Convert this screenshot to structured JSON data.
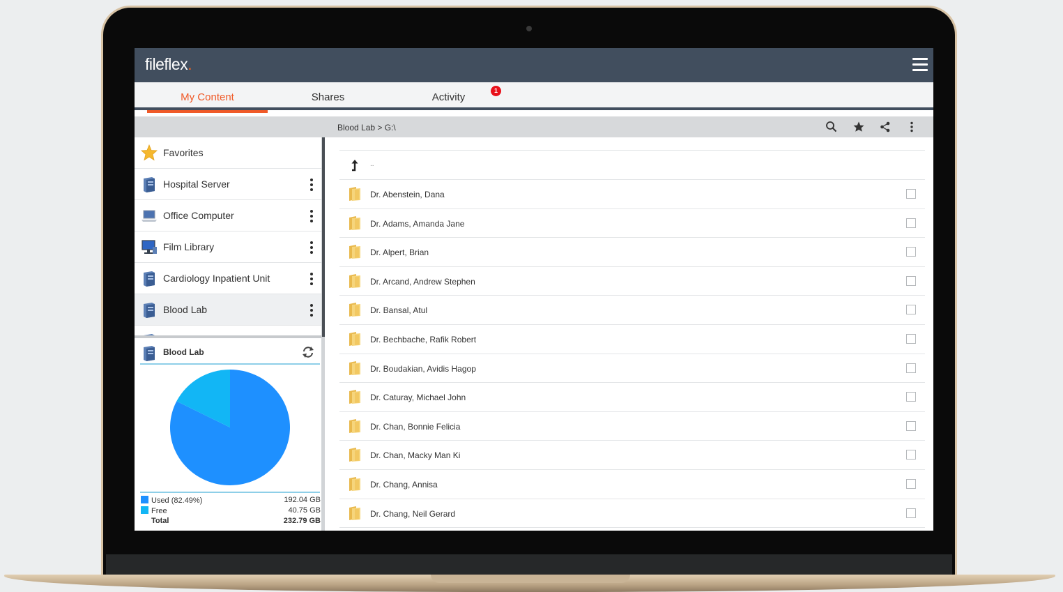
{
  "app": {
    "logo_text": "fileflex",
    "logo_dot": "."
  },
  "tabs": [
    {
      "label": "My Content",
      "active": true
    },
    {
      "label": "Shares",
      "active": false
    },
    {
      "label": "Activity",
      "active": false,
      "badge": "1"
    }
  ],
  "pathbar": {
    "breadcrumb": "Blood Lab > G:\\"
  },
  "sidebar": {
    "items": [
      {
        "label": "Favorites",
        "icon": "star-icon"
      },
      {
        "label": "Hospital Server",
        "icon": "server-icon"
      },
      {
        "label": "Office Computer",
        "icon": "laptop-icon"
      },
      {
        "label": "Film Library",
        "icon": "monitor-icon"
      },
      {
        "label": "Cardiology Inpatient Unit",
        "icon": "server-icon"
      },
      {
        "label": "Blood Lab",
        "icon": "server-icon",
        "selected": true
      }
    ]
  },
  "storage": {
    "title": "Blood Lab",
    "used_label": "Used (82.49%)",
    "used_value": "192.04 GB",
    "free_label": "Free",
    "free_value": "40.75 GB",
    "total_label": "Total",
    "total_value": "232.79 GB",
    "used_fraction": 0.8249,
    "colors": {
      "used": "#1e90ff",
      "free": "#12b6f5"
    }
  },
  "files": {
    "up_label": "..",
    "items": [
      "Dr. Abenstein, Dana",
      "Dr. Adams, Amanda Jane",
      "Dr. Alpert, Brian",
      "Dr. Arcand, Andrew Stephen",
      "Dr. Bansal, Atul",
      "Dr. Bechbache, Rafik Robert",
      "Dr. Boudakian, Avidis Hagop",
      "Dr. Caturay, Michael John",
      "Dr. Chan, Bonnie Felicia",
      "Dr. Chan, Macky Man Ki",
      "Dr. Chang, Annisa",
      "Dr. Chang, Neil Gerard"
    ]
  },
  "colors": {
    "accent": "#f05a28",
    "header": "#414e5e",
    "badge": "#e8101a"
  }
}
